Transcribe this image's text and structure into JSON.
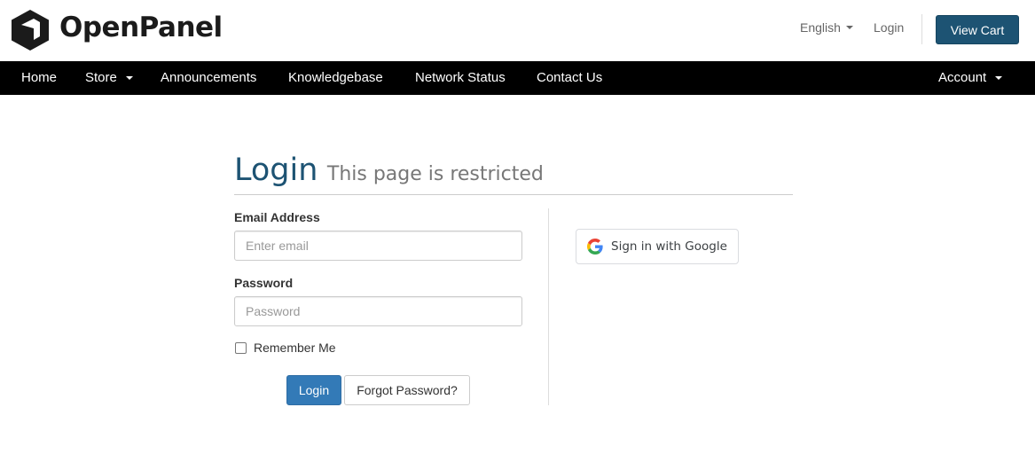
{
  "header": {
    "brand": "OpenPanel",
    "language": "English",
    "login_link": "Login",
    "cart_button": "View Cart"
  },
  "nav": {
    "home": "Home",
    "store": "Store",
    "announcements": "Announcements",
    "knowledgebase": "Knowledgebase",
    "network_status": "Network Status",
    "contact_us": "Contact Us",
    "account": "Account"
  },
  "page": {
    "title": "Login",
    "subtitle": "This page is restricted"
  },
  "form": {
    "email_label": "Email Address",
    "email_placeholder": "Enter email",
    "password_label": "Password",
    "password_placeholder": "Password",
    "remember_label": "Remember Me",
    "login_button": "Login",
    "forgot_button": "Forgot Password?"
  },
  "social": {
    "google_button": "Sign in with Google"
  },
  "colors": {
    "brand_blue": "#1d5373",
    "primary_button": "#337ab7",
    "navbar": "#000000"
  },
  "icons": [
    "openpanel-logo-icon",
    "caret-down-icon",
    "google-g-icon"
  ]
}
